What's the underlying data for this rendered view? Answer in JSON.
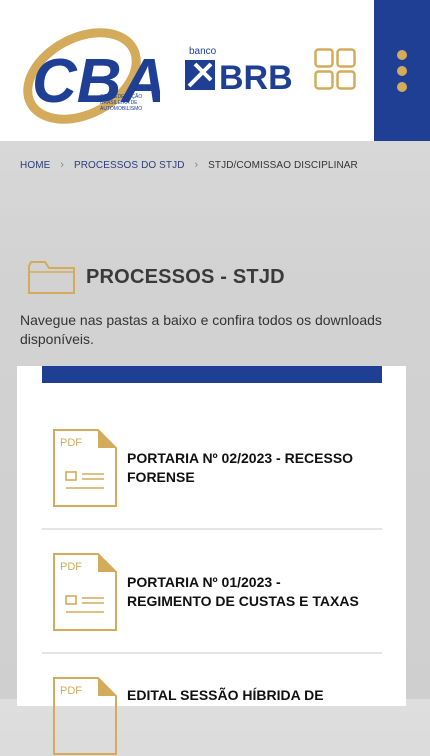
{
  "header": {
    "logo": {
      "letters": "CBA",
      "subtitle_lines": [
        "CONFEDERAÇÃO",
        "BRASILEIRA DE",
        "AUTOMOBILISMO"
      ]
    },
    "sponsor": {
      "top": "banco",
      "name": "BRB"
    },
    "icons": {
      "apps": "apps-grid-icon",
      "menu": "vertical-dots-icon"
    }
  },
  "breadcrumb": {
    "items": [
      "HOME",
      "PROCESSOS DO STJD",
      "STJD/COMISSAO DISCIPLINAR"
    ]
  },
  "page": {
    "title": "PROCESSOS - STJD",
    "intro": "Navegue nas pastas a baixo e confira todos os downloads disponíveis."
  },
  "documents": [
    {
      "type": "PDF",
      "title_lines": [
        "PORTARIA Nº 02/2023 - RECESSO",
        "FORENSE"
      ]
    },
    {
      "type": "PDF",
      "title_lines": [
        "PORTARIA Nº 01/2023 -",
        "REGIMENTO DE CUSTAS E TAXAS"
      ]
    },
    {
      "type": "PDF",
      "title_lines": [
        "EDITAL SESSÃO HÍBRIDA DE"
      ]
    }
  ],
  "colors": {
    "navy": "#1f3f95",
    "gold": "#d3ab5a",
    "text": "#3a3a3a"
  }
}
